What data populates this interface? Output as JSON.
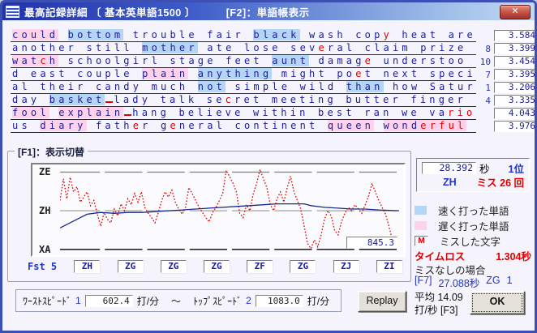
{
  "window": {
    "title_left": "最高記録詳細 〔 基本英単語1500 〕",
    "title_right": "[F2]：単語帳表示",
    "close_glyph": "✕"
  },
  "colors": {
    "fast_word_bg": "#b4d6f6",
    "slow_word_bg": "#ffd2ec",
    "miss_char": "#dd0000",
    "word_text": "#1c1c96",
    "accent_blue": "#2233cc",
    "titlebar_left": "#2233aa",
    "titlebar_right": "#c2d9f4"
  },
  "word_panel": {
    "lines": [
      {
        "num": "",
        "value": "3.584",
        "tokens": [
          {
            "t": "could",
            "h": "slow"
          },
          {
            "t": "bottom",
            "h": "fast"
          },
          {
            "t": "trouble"
          },
          {
            "t": "fair"
          },
          {
            "t": "black",
            "h": "fast"
          },
          {
            "t": "wash"
          },
          {
            "t": "copy",
            "r": [
              3
            ]
          },
          {
            "t": "heat"
          },
          {
            "t": "are"
          }
        ]
      },
      {
        "num": "8",
        "value": "3.399",
        "tokens": [
          {
            "t": "another"
          },
          {
            "t": "still"
          },
          {
            "t": "mother",
            "h": "fast"
          },
          {
            "t": "ate"
          },
          {
            "t": "lose"
          },
          {
            "t": "several",
            "r": [
              3
            ]
          },
          {
            "t": "claim"
          },
          {
            "t": "prize"
          }
        ]
      },
      {
        "num": "10",
        "value": "3.454",
        "tokens": [
          {
            "t": "watch",
            "h": "slow",
            "r": [
              3
            ]
          },
          {
            "t": "schoolgirl"
          },
          {
            "t": "stage"
          },
          {
            "t": "feet"
          },
          {
            "t": "aunt",
            "h": "fast"
          },
          {
            "t": "damage",
            "r": [
              5
            ]
          },
          {
            "t": "understoo"
          }
        ]
      },
      {
        "num": "7",
        "value": "3.395",
        "tokens": [
          {
            "t": "d"
          },
          {
            "t": "east"
          },
          {
            "t": "couple"
          },
          {
            "t": "plain",
            "h": "slow"
          },
          {
            "t": "anything",
            "h": "fast"
          },
          {
            "t": "might"
          },
          {
            "t": "poet",
            "r": [
              2
            ]
          },
          {
            "t": "next"
          },
          {
            "t": "speci"
          }
        ]
      },
      {
        "num": "1",
        "value": "3.206",
        "tokens": [
          {
            "t": "al"
          },
          {
            "t": "their"
          },
          {
            "t": "candy"
          },
          {
            "t": "much"
          },
          {
            "t": "not",
            "h": "fast"
          },
          {
            "t": "simple"
          },
          {
            "t": "wild"
          },
          {
            "t": "than",
            "h": "fast"
          },
          {
            "t": "how"
          },
          {
            "t": "Satur"
          }
        ]
      },
      {
        "num": "4",
        "value": "3.335",
        "tokens": [
          {
            "t": "day"
          },
          {
            "t": "basket",
            "h": "fast"
          },
          {
            "rs": true
          },
          {
            "t": "lady"
          },
          {
            "t": "talk"
          },
          {
            "t": "secret",
            "r": [
              2
            ]
          },
          {
            "t": "meeting"
          },
          {
            "t": "butter"
          },
          {
            "t": "finger"
          }
        ]
      },
      {
        "num": "",
        "value": "4.043",
        "tokens": [
          {
            "t": "fool",
            "h": "slow"
          },
          {
            "t": "explain",
            "h": "slow"
          },
          {
            "rs": true
          },
          {
            "t": "hang"
          },
          {
            "t": "believe"
          },
          {
            "t": "within"
          },
          {
            "t": "best"
          },
          {
            "t": "ran"
          },
          {
            "t": "we"
          },
          {
            "t": "vario",
            "r": [
              2,
              3,
              4
            ]
          }
        ]
      },
      {
        "num": "",
        "value": "3.976",
        "tokens": [
          {
            "t": "us"
          },
          {
            "t": "diary",
            "h": "slow"
          },
          {
            "t": "father",
            "r": [
              4
            ]
          },
          {
            "t": "general",
            "r": [
              1
            ]
          },
          {
            "t": "continent"
          },
          {
            "t": "queen",
            "h": "slow"
          },
          {
            "t": "wonderful",
            "h": "slow",
            "r": [
              4,
              5,
              6,
              7,
              8
            ]
          }
        ]
      }
    ]
  },
  "graph": {
    "box_label": "[F1]：表示切替",
    "fst_label": "Fst",
    "fst_num": "5",
    "grade_boxes": [
      "ZH",
      "ZG",
      "ZG",
      "ZG",
      "ZF",
      "ZG",
      "ZJ",
      "ZI"
    ],
    "current_value": "845.3"
  },
  "chart_data": {
    "type": "line",
    "title": "[F1]：表示切替",
    "xlabel": "",
    "ylabel": "speed grade",
    "y_axis_labels": [
      "ZE",
      "ZH",
      "XA"
    ],
    "y_grid_positions_pct": [
      93,
      48,
      3
    ],
    "x_segment_labels": [
      "ZH",
      "ZG",
      "ZG",
      "ZG",
      "ZF",
      "ZG",
      "ZJ",
      "ZI"
    ],
    "current_value": 845.3,
    "grid": true,
    "legend_position": "none",
    "series": [
      {
        "name": "red-dotted-line",
        "color": "#dd0000",
        "style": "dotted",
        "points": [
          [
            0,
            60
          ],
          [
            1,
            85
          ],
          [
            2,
            62
          ],
          [
            3,
            87
          ],
          [
            4,
            70
          ],
          [
            5,
            76
          ],
          [
            6,
            58
          ],
          [
            7,
            64
          ],
          [
            8,
            70
          ],
          [
            9,
            54
          ],
          [
            10,
            60
          ],
          [
            11,
            44
          ],
          [
            12,
            30
          ],
          [
            13,
            46
          ],
          [
            14,
            38
          ],
          [
            15,
            34
          ],
          [
            16,
            50
          ],
          [
            17,
            42
          ],
          [
            18,
            56
          ],
          [
            19,
            48
          ],
          [
            20,
            62
          ],
          [
            21,
            55
          ],
          [
            22,
            68
          ],
          [
            23,
            58
          ],
          [
            24,
            70
          ],
          [
            25,
            52
          ],
          [
            26,
            45
          ],
          [
            27,
            40
          ],
          [
            28,
            34
          ],
          [
            29,
            46
          ],
          [
            30,
            60
          ],
          [
            31,
            70
          ],
          [
            32,
            64
          ],
          [
            33,
            72
          ],
          [
            34,
            58
          ],
          [
            35,
            50
          ],
          [
            36,
            44
          ],
          [
            37,
            52
          ],
          [
            38,
            75
          ],
          [
            39,
            68
          ],
          [
            40,
            60
          ],
          [
            41,
            52
          ],
          [
            42,
            46
          ],
          [
            43,
            40
          ],
          [
            44,
            35
          ],
          [
            45,
            46
          ],
          [
            46,
            52
          ],
          [
            47,
            60
          ],
          [
            48,
            68
          ],
          [
            49,
            95
          ],
          [
            50,
            88
          ],
          [
            51,
            80
          ],
          [
            52,
            70
          ],
          [
            53,
            45
          ],
          [
            54,
            40
          ],
          [
            55,
            55
          ],
          [
            56,
            48
          ],
          [
            57,
            68
          ],
          [
            58,
            80
          ],
          [
            59,
            96
          ],
          [
            60,
            85
          ],
          [
            61,
            75
          ],
          [
            62,
            55
          ],
          [
            63,
            48
          ],
          [
            64,
            62
          ],
          [
            65,
            70
          ],
          [
            66,
            58
          ],
          [
            67,
            75
          ],
          [
            68,
            88
          ],
          [
            69,
            70
          ],
          [
            70,
            60
          ],
          [
            71,
            50
          ],
          [
            72,
            30
          ],
          [
            73,
            10
          ],
          [
            74,
            4
          ],
          [
            75,
            14
          ],
          [
            76,
            6
          ],
          [
            77,
            20
          ],
          [
            78,
            38
          ],
          [
            79,
            48
          ],
          [
            80,
            42
          ],
          [
            81,
            25
          ],
          [
            82,
            20
          ],
          [
            83,
            35
          ],
          [
            84,
            45
          ],
          [
            85,
            52
          ],
          [
            86,
            48
          ],
          [
            87,
            55
          ],
          [
            88,
            50
          ],
          [
            89,
            45
          ],
          [
            90,
            55
          ],
          [
            91,
            65
          ],
          [
            92,
            80
          ],
          [
            93,
            70
          ],
          [
            94,
            60
          ],
          [
            95,
            52
          ],
          [
            96,
            44
          ],
          [
            97,
            30
          ],
          [
            98,
            14
          ],
          [
            99,
            4
          ]
        ]
      },
      {
        "name": "blue-solid-line",
        "color": "#152a8c",
        "style": "solid",
        "points": [
          [
            0,
            28
          ],
          [
            2,
            32
          ],
          [
            4,
            36
          ],
          [
            6,
            40
          ],
          [
            8,
            44
          ],
          [
            12,
            46
          ],
          [
            16,
            45
          ],
          [
            20,
            46
          ],
          [
            24,
            46
          ],
          [
            28,
            47
          ],
          [
            32,
            48
          ],
          [
            36,
            49
          ],
          [
            40,
            50
          ],
          [
            44,
            51
          ],
          [
            48,
            52
          ],
          [
            52,
            53
          ],
          [
            56,
            54
          ],
          [
            60,
            55
          ],
          [
            64,
            56
          ],
          [
            68,
            56
          ],
          [
            72,
            56
          ],
          [
            74,
            54
          ],
          [
            78,
            52
          ],
          [
            82,
            51
          ],
          [
            86,
            50
          ],
          [
            90,
            50
          ],
          [
            94,
            49
          ],
          [
            100,
            48
          ]
        ]
      }
    ]
  },
  "stats": {
    "time": "28.392",
    "time_unit": "秒",
    "rank": "1位",
    "grade": "ZH",
    "miss": "ミス 26 回"
  },
  "legend_items": [
    {
      "type": "fast",
      "label": "速く打った単語"
    },
    {
      "type": "slow",
      "label": "遅く打った単語"
    },
    {
      "type": "m",
      "glyph": "M",
      "label": "ミスした文字"
    }
  ],
  "timeloss": {
    "label": "タイムロス",
    "value": "1.304秒"
  },
  "no_miss": {
    "label": "ミスなしの場合",
    "key": "[F7]",
    "time": "27.088秒",
    "grade": "ZG",
    "rank": "1"
  },
  "average": {
    "line1": "平均 14.09",
    "line2": "打/秒 [F3]"
  },
  "ok": {
    "label": "OK"
  },
  "replay": {
    "label": "Replay"
  },
  "speed_bar": {
    "worst_label": "ﾜｰｽﾄｽﾋﾟｰﾄﾞ",
    "worst_num": "1",
    "worst_value": "602.4",
    "unit": "打/分",
    "tilde": "～",
    "top_label": "ﾄｯﾌﾟｽﾋﾟｰﾄﾞ",
    "top_num": "2",
    "top_value": "1083.0"
  }
}
